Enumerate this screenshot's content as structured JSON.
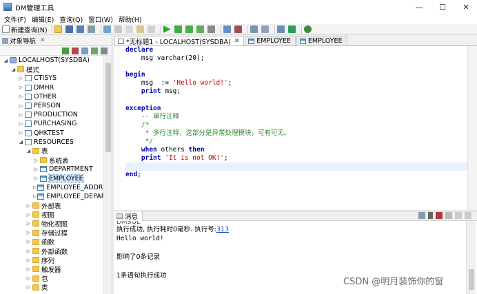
{
  "window": {
    "title": "DM管理工具",
    "controls": {
      "minimize": "—",
      "maximize": "☐",
      "close": "✕"
    }
  },
  "menu": [
    "文件(F)",
    "编辑(E)",
    "查询(Q)",
    "窗口(W)",
    "帮助(H)"
  ],
  "toolbar": {
    "new_query_label": "新建查询(N)"
  },
  "navigator": {
    "title": "对象导航",
    "tree": [
      {
        "label": "LOCALHOST(SYSDBA)",
        "level": 0,
        "expanded": true,
        "icon": "db"
      },
      {
        "label": "模式",
        "level": 1,
        "expanded": true,
        "icon": "folder"
      },
      {
        "label": "CTISYS",
        "level": 2,
        "expanded": false,
        "icon": "schema"
      },
      {
        "label": "DMHR",
        "level": 2,
        "expanded": false,
        "icon": "schema"
      },
      {
        "label": "OTHER",
        "level": 2,
        "expanded": false,
        "icon": "schema"
      },
      {
        "label": "PERSON",
        "level": 2,
        "expanded": false,
        "icon": "schema"
      },
      {
        "label": "PRODUCTION",
        "level": 2,
        "expanded": false,
        "icon": "schema"
      },
      {
        "label": "PURCHASING",
        "level": 2,
        "expanded": false,
        "icon": "schema"
      },
      {
        "label": "QHKTEST",
        "level": 2,
        "expanded": false,
        "icon": "schema"
      },
      {
        "label": "RESOURCES",
        "level": 2,
        "expanded": true,
        "icon": "schema"
      },
      {
        "label": "表",
        "level": 3,
        "expanded": true,
        "icon": "folder"
      },
      {
        "label": "系统表",
        "level": 4,
        "expanded": false,
        "icon": "folder"
      },
      {
        "label": "DEPARTMENT",
        "level": 4,
        "expanded": false,
        "icon": "table"
      },
      {
        "label": "EMPLOYEE",
        "level": 4,
        "expanded": false,
        "icon": "table",
        "selected": true
      },
      {
        "label": "EMPLOYEE_ADDRE",
        "level": 4,
        "expanded": false,
        "icon": "table"
      },
      {
        "label": "EMPLOYEE_DEPART",
        "level": 4,
        "expanded": false,
        "icon": "table"
      },
      {
        "label": "外部表",
        "level": 3,
        "expanded": false,
        "icon": "folder"
      },
      {
        "label": "视图",
        "level": 3,
        "expanded": false,
        "icon": "folder"
      },
      {
        "label": "物化视图",
        "level": 3,
        "expanded": false,
        "icon": "folder"
      },
      {
        "label": "存储过程",
        "level": 3,
        "expanded": false,
        "icon": "folder"
      },
      {
        "label": "函数",
        "level": 3,
        "expanded": false,
        "icon": "folder"
      },
      {
        "label": "外部函数",
        "level": 3,
        "expanded": false,
        "icon": "folder"
      },
      {
        "label": "序列",
        "level": 3,
        "expanded": false,
        "icon": "folder"
      },
      {
        "label": "触发器",
        "level": 3,
        "expanded": false,
        "icon": "folder"
      },
      {
        "label": "包",
        "level": 3,
        "expanded": false,
        "icon": "folder"
      },
      {
        "label": "类",
        "level": 3,
        "expanded": false,
        "icon": "folder"
      }
    ]
  },
  "editor": {
    "tabs": [
      {
        "label": "*无标题1 - LOCALHOST(SYSDBA)",
        "active": true,
        "closable": true
      },
      {
        "label": "EMPLOYEE",
        "active": false,
        "closable": false
      },
      {
        "label": "EMPLOYEE",
        "active": false,
        "closable": false
      }
    ],
    "lines": [
      [
        {
          "t": "declare",
          "c": "kw"
        }
      ],
      [
        {
          "t": "    msg ",
          "c": "plain"
        },
        {
          "t": "varchar",
          "c": "ty"
        },
        {
          "t": "(20);",
          "c": "plain"
        }
      ],
      [],
      [
        {
          "t": "begin",
          "c": "kw"
        }
      ],
      [
        {
          "t": "    msg  := ",
          "c": "plain"
        },
        {
          "t": "'Hello world!'",
          "c": "str"
        },
        {
          "t": ";",
          "c": "plain"
        }
      ],
      [
        {
          "t": "    ",
          "c": "plain"
        },
        {
          "t": "print",
          "c": "kw"
        },
        {
          "t": " msg;",
          "c": "plain"
        }
      ],
      [],
      [
        {
          "t": "exception",
          "c": "kw"
        }
      ],
      [
        {
          "t": "    -- 单行注释",
          "c": "cmt"
        }
      ],
      [
        {
          "t": "    /*",
          "c": "cmt"
        }
      ],
      [
        {
          "t": "     * 多行注释，这部分是异常处理模块，可有可无。",
          "c": "cmt"
        }
      ],
      [
        {
          "t": "     */",
          "c": "cmt"
        }
      ],
      [
        {
          "t": "    ",
          "c": "plain"
        },
        {
          "t": "when",
          "c": "kw"
        },
        {
          "t": " others ",
          "c": "plain"
        },
        {
          "t": "then",
          "c": "kw"
        }
      ],
      [
        {
          "t": "    ",
          "c": "plain"
        },
        {
          "t": "print",
          "c": "kw"
        },
        {
          "t": " ",
          "c": "plain"
        },
        {
          "t": "'It is not OK!'",
          "c": "str"
        },
        {
          "t": ";",
          "c": "plain"
        }
      ],
      [],
      [
        {
          "t": "end",
          "c": "kw"
        },
        {
          "t": ";",
          "c": "plain"
        }
      ]
    ],
    "highlight_line": 14
  },
  "messages": {
    "tab_label": "消息",
    "lines": [
      {
        "text": "执行成功, 执行耗时0毫秒. 执行号:",
        "link": "313"
      },
      {
        "text": "Hello world!",
        "mono": true
      },
      {
        "text": ""
      },
      {
        "text": "影响了0条记录"
      },
      {
        "text": ""
      },
      {
        "text": "1条语句执行成功"
      }
    ],
    "cut_top_text": "DMSQL"
  },
  "watermark": "CSDN @明月装饰你的窗"
}
